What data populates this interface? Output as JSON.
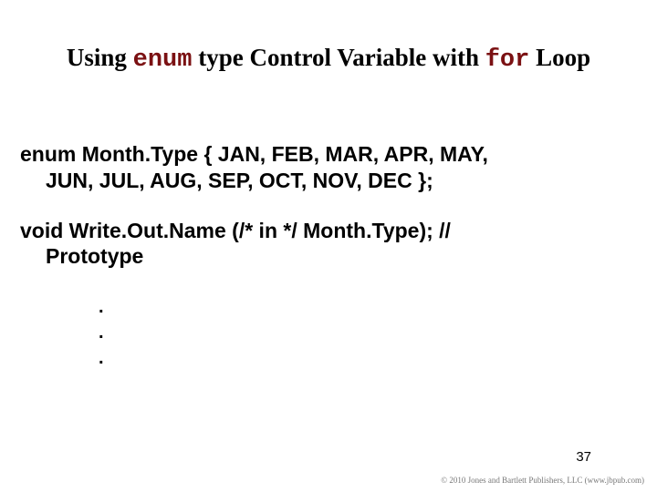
{
  "title": {
    "pre": "Using ",
    "kw1": "enum",
    "mid": " type Control Variable with ",
    "kw2": "for",
    "post": " Loop"
  },
  "code": {
    "line1a": "enum  Month.Type { JAN,  FEB,  MAR,  APR,  MAY,",
    "line1b": "JUN, JUL,  AUG,  SEP,  OCT,  NOV,  DEC };",
    "line2a": "void  Write.Out.Name (/* in */ Month.Type); //",
    "line2b": "Prototype"
  },
  "dots": {
    "d1": ".",
    "d2": ".",
    "d3": "."
  },
  "page_number": "37",
  "copyright": "© 2010 Jones and Bartlett Publishers, LLC (www.jbpub.com)"
}
